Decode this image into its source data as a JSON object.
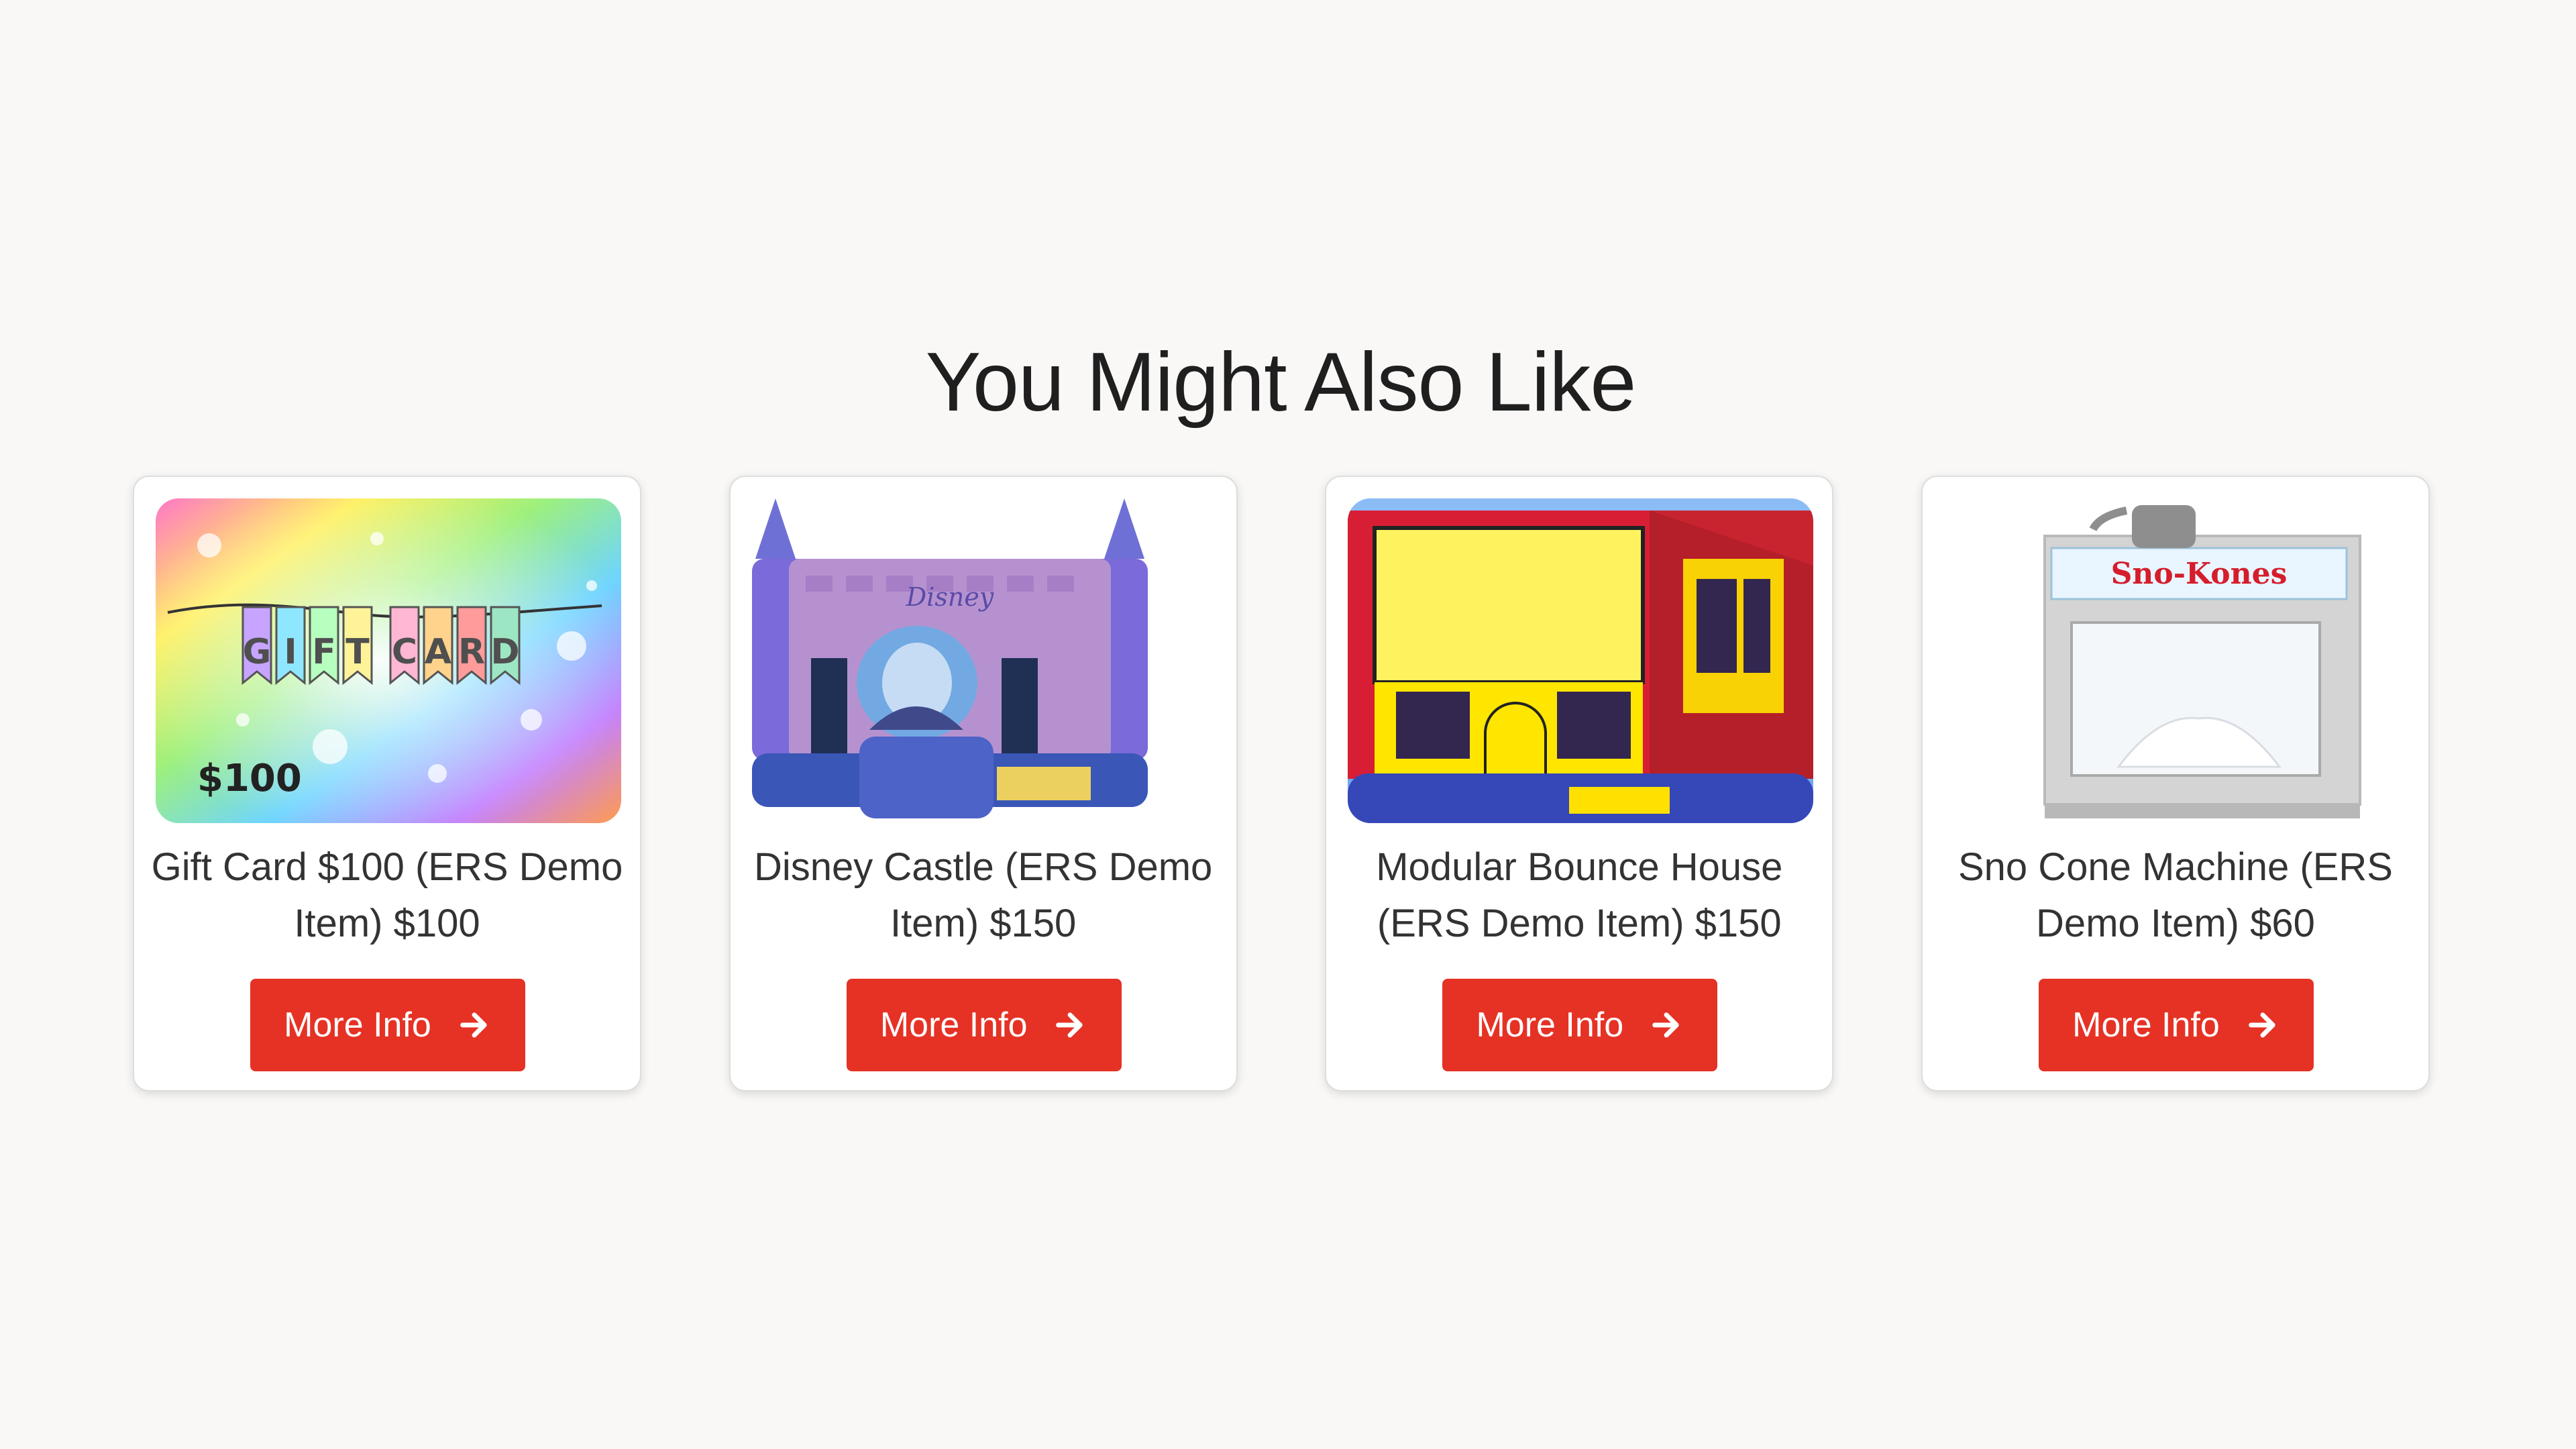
{
  "section": {
    "title": "You Might Also Like"
  },
  "products": [
    {
      "title": "Gift Card $100 (ERS Demo Item) $100",
      "button_label": "More Info",
      "image_name": "gift-card-image",
      "image_text": "GIFT CARD $100"
    },
    {
      "title": "Disney Castle (ERS Demo Item) $150",
      "button_label": "More Info",
      "image_name": "disney-castle-image",
      "image_text": "Disney"
    },
    {
      "title": "Modular Bounce House (ERS Demo Item) $150",
      "button_label": "More Info",
      "image_name": "modular-bounce-house-image"
    },
    {
      "title": "Sno Cone Machine (ERS Demo Item) $60",
      "button_label": "More Info",
      "image_name": "sno-cone-machine-image",
      "image_text": "Sno-Kones"
    }
  ],
  "colors": {
    "background": "#f9f8f6",
    "button": "#e53225",
    "title_text": "#1f1f1f",
    "card_text": "#333333"
  }
}
